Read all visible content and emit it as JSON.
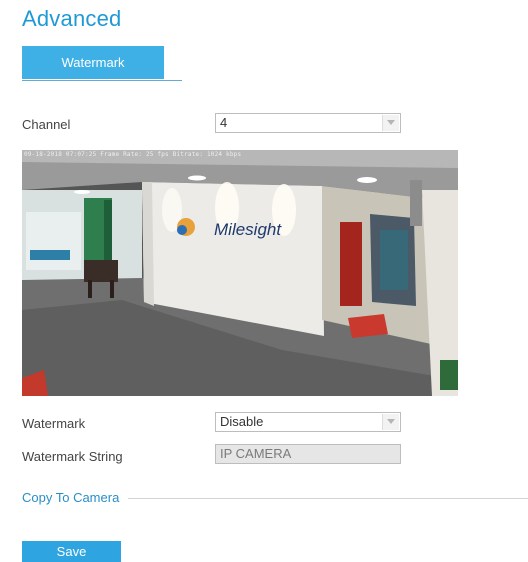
{
  "page": {
    "title": "Advanced"
  },
  "tabs": [
    {
      "label": "Watermark",
      "active": true
    }
  ],
  "form": {
    "channel": {
      "label": "Channel",
      "value": "4"
    },
    "watermark": {
      "label": "Watermark",
      "value": "Disable"
    },
    "watermark_string": {
      "label": "Watermark String",
      "value": "IP CAMERA"
    }
  },
  "preview": {
    "osd_text": "09-18-2018 07:07:25 Frame Rate: 25 fps  Bitrate: 1024 kbps",
    "wall_logo_text": "Milesight"
  },
  "copy_to_camera": {
    "label": "Copy To Camera"
  },
  "actions": {
    "save_label": "Save"
  },
  "colors": {
    "accent": "#1f9ad6",
    "tab_bg": "#3fb0e6",
    "button_bg": "#2ea5e0"
  },
  "icons": {
    "dropdown": "chevron-down-icon"
  }
}
